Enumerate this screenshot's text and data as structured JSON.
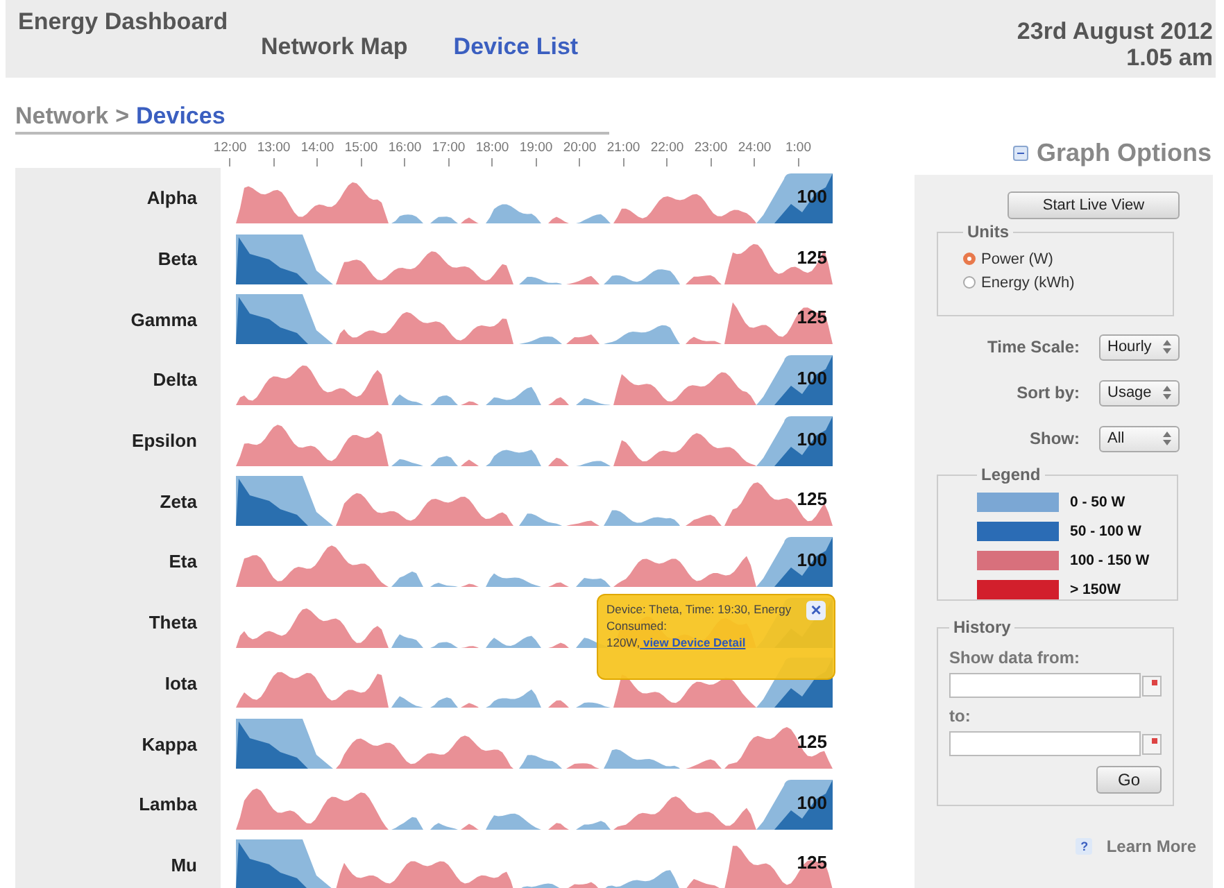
{
  "header": {
    "title": "Energy Dashboard",
    "nav": [
      {
        "label": "Network Map",
        "selected": false
      },
      {
        "label": "Device List",
        "selected": true
      }
    ],
    "date": "23rd August 2012",
    "time": "1.05 am"
  },
  "breadcrumb": {
    "parent": "Network",
    "separator": ">",
    "current": "Devices"
  },
  "time_axis": [
    "12:00",
    "13:00",
    "14:00",
    "15:00",
    "16:00",
    "17:00",
    "18:00",
    "19:00",
    "20:00",
    "21:00",
    "22:00",
    "23:00",
    "24:00",
    "1:00"
  ],
  "devices": [
    {
      "name": "Alpha",
      "kind": "rising",
      "reading": "100"
    },
    {
      "name": "Beta",
      "kind": "falling",
      "reading": "125"
    },
    {
      "name": "Gamma",
      "kind": "falling",
      "reading": "125"
    },
    {
      "name": "Delta",
      "kind": "rising",
      "reading": "100"
    },
    {
      "name": "Epsilon",
      "kind": "rising",
      "reading": "100"
    },
    {
      "name": "Zeta",
      "kind": "falling",
      "reading": "125"
    },
    {
      "name": "Eta",
      "kind": "rising",
      "reading": "100"
    },
    {
      "name": "Theta",
      "kind": "rising"
    },
    {
      "name": "Iota",
      "kind": "rising"
    },
    {
      "name": "Kappa",
      "kind": "falling",
      "reading": "125"
    },
    {
      "name": "Lamba",
      "kind": "rising",
      "reading": "100"
    },
    {
      "name": "Mu",
      "kind": "falling",
      "reading": "125"
    }
  ],
  "tooltip": {
    "text": "Device: Theta, Time: 19:30, Energy Consumed: 120W,",
    "link": " view Device Detail",
    "close": "×"
  },
  "graph_options": {
    "title": "Graph Options",
    "expanded": true,
    "live_button": "Start Live View",
    "units": {
      "title": "Units",
      "options": [
        {
          "label": "Power (W)",
          "selected": true
        },
        {
          "label": "Energy (kWh)",
          "selected": false
        }
      ]
    },
    "selects": [
      {
        "label": "Time Scale:",
        "value": "Hourly"
      },
      {
        "label": "Sort by:",
        "value": "Usage"
      },
      {
        "label": "Show:",
        "value": "All"
      }
    ],
    "legend": {
      "title": "Legend",
      "items": [
        {
          "label": "0 - 50 W",
          "color": "#7ba7d4"
        },
        {
          "label": "50 - 100 W",
          "color": "#2b6cb5"
        },
        {
          "label": "100 - 150 W",
          "color": "#d8707c"
        },
        {
          "label": "> 150W",
          "color": "#d21f2c"
        }
      ]
    },
    "history": {
      "title": "History",
      "from_label": "Show data from:",
      "to_label": "to:",
      "go": "Go"
    },
    "learn_more": {
      "icon": "?",
      "label": "Learn More"
    }
  }
}
